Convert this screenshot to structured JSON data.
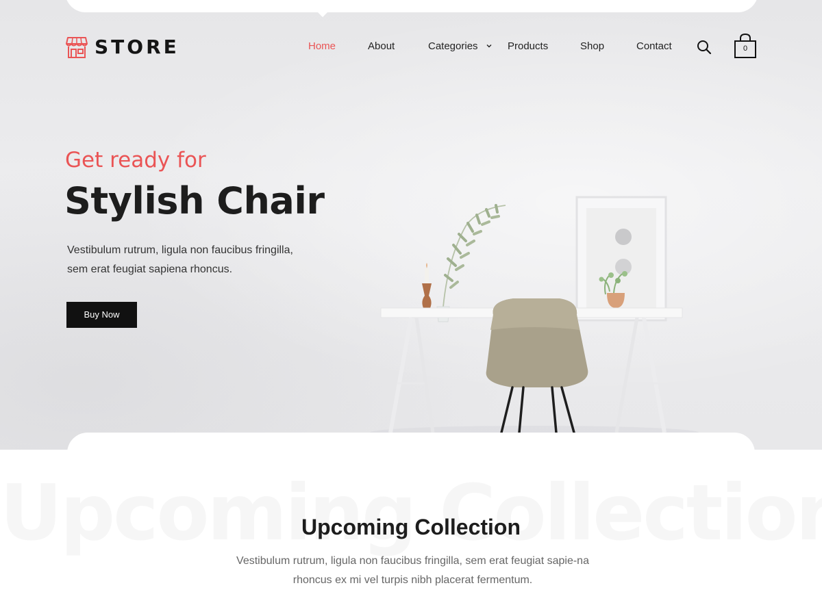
{
  "brand": {
    "name": "STORE",
    "logo_icon": "storefront-icon",
    "accent": "#ea5455"
  },
  "nav": {
    "items": [
      {
        "label": "Home",
        "active": true
      },
      {
        "label": "About",
        "active": false
      },
      {
        "label": "Categories",
        "active": false,
        "has_dropdown": true,
        "caret_icon": "chevron-down-icon"
      },
      {
        "label": "Products",
        "active": false
      },
      {
        "label": "Shop",
        "active": false
      },
      {
        "label": "Contact",
        "active": false
      }
    ],
    "search_icon": "search-icon",
    "cart": {
      "icon": "shopping-bag-icon",
      "count": "0"
    }
  },
  "hero": {
    "kicker": "Get ready for",
    "title": "Stylish Chair",
    "description": "Vestibulum rutrum, ligula non faucibus fringilla, sem erat feugiat sapiena rhoncus.",
    "button_label": "Buy Now"
  },
  "collection": {
    "ghost_title": "Upcoming Collection",
    "title": "Upcoming Collection",
    "description": "Vestibulum rutrum, ligula non faucibus fringilla, sem erat feugiat sapie-na rhoncus ex mi vel turpis nibh placerat fermentum."
  }
}
